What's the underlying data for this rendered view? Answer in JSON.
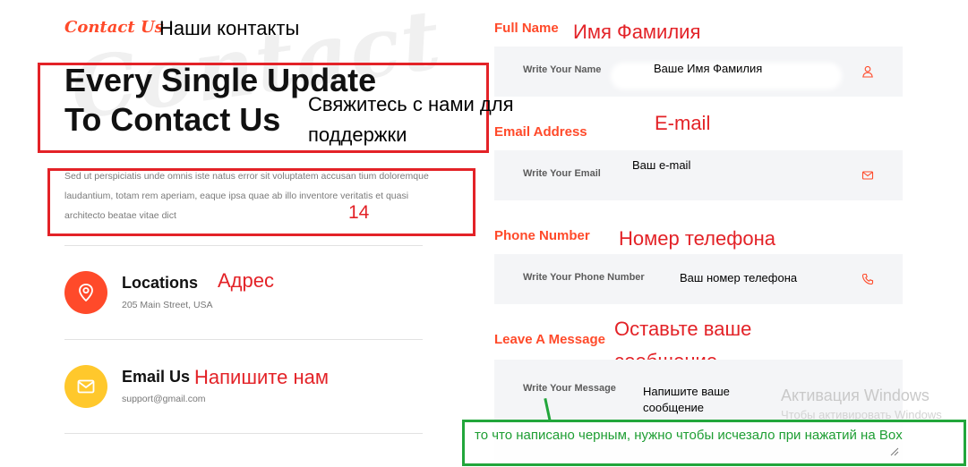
{
  "header": {
    "script_title": "Contact Us",
    "watermark": "Contact",
    "note_contacts": "Наши контакты"
  },
  "headline": {
    "line1": "Every Single Update",
    "line2": "To Contact Us",
    "note": "Свяжитесь с нами для поддержки"
  },
  "description": {
    "text": "Sed ut perspiciatis unde omnis iste natus error sit voluptatem accusan tium doloremque laudantium, totam rem aperiam, eaque ipsa quae ab illo inventore veritatis et quasi architecto beatae vitae dict",
    "note": "14"
  },
  "info": [
    {
      "title": "Locations",
      "sub": "205 Main Street, USA",
      "note": "Адрес",
      "icon": "map-pin-icon",
      "color": "#ff4a2a"
    },
    {
      "title": "Email Us",
      "sub": "support@gmail.com",
      "note": "Напишите нам",
      "icon": "envelope-icon",
      "color": "#ffc82c"
    }
  ],
  "form": {
    "full_name": {
      "label": "Full Name",
      "note": "Имя Фамилия",
      "placeholder": "Write Your Name",
      "value": "Ваше Имя Фамилия",
      "icon": "user-icon"
    },
    "email": {
      "label": "Email Address",
      "note": "E-mail",
      "placeholder": "Write Your Email",
      "value": "Ваш e-mail",
      "icon": "envelope-icon"
    },
    "phone": {
      "label": "Phone Number",
      "note": "Номер телефона",
      "placeholder": "Write Your Phone Number",
      "value": "Ваш номер телефона",
      "icon": "phone-icon"
    },
    "message": {
      "label": "Leave A Message",
      "note_line1": "Оставьте ваше",
      "note_line2": "сообщение",
      "placeholder": "Write Your Message",
      "value_line1": "Напишите ваше",
      "value_line2": "сообщение"
    }
  },
  "annotation": {
    "text": "то что написано черным, нужно чтобы исчезало при нажатий на Box"
  },
  "windows_watermark": {
    "title": "Активация Windows",
    "sub": "Чтобы активировать Windows"
  },
  "colors": {
    "accent": "#ff4a2a",
    "yellow": "#ffc82c",
    "annotation_red": "#e32227",
    "annotation_green": "#22a63b",
    "field_bg": "#f4f5f7"
  }
}
